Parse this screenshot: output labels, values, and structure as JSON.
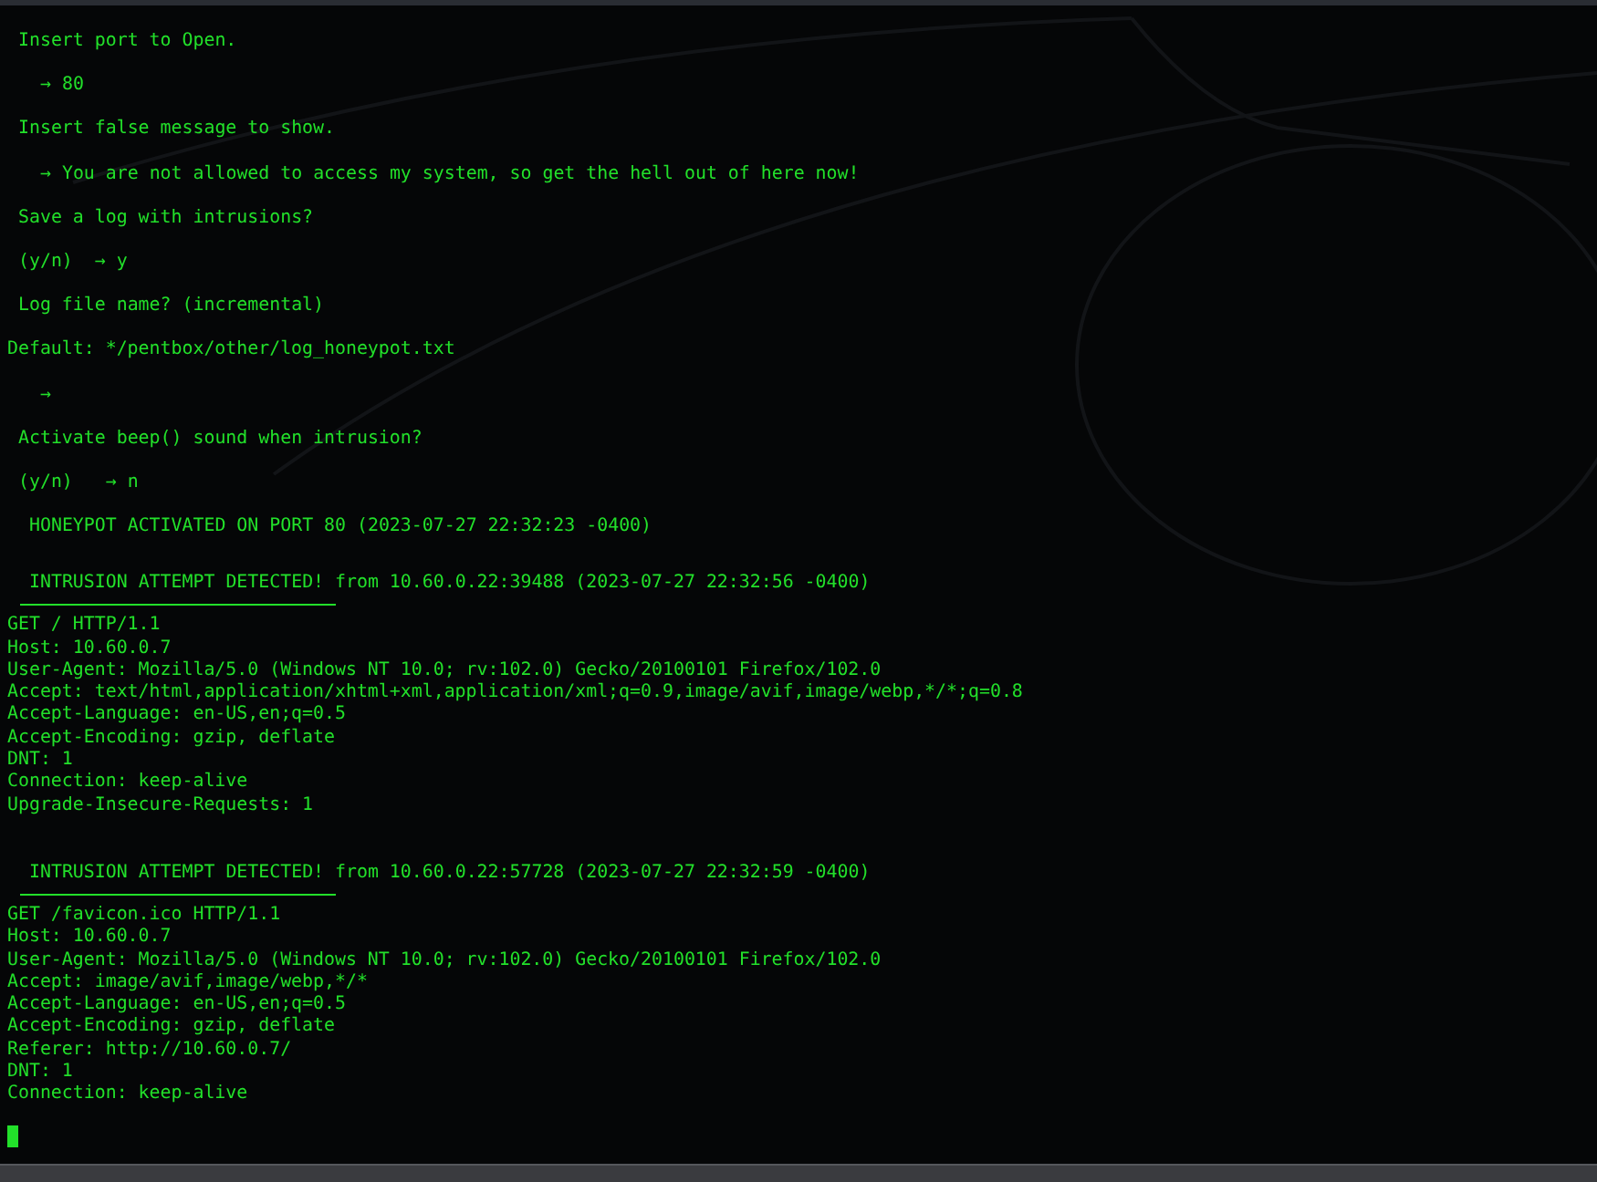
{
  "prompts": [
    {
      "kind": "question",
      "text": "Insert port to Open."
    },
    {
      "kind": "answer",
      "text": "→ 80"
    },
    {
      "kind": "question",
      "text": "Insert false message to show."
    },
    {
      "kind": "answer",
      "text": "→ You are not allowed to access my system, so get the hell out of here now!"
    },
    {
      "kind": "question",
      "text": "Save a log with intrusions?"
    },
    {
      "kind": "question",
      "text": "(y/n)  → y"
    },
    {
      "kind": "question",
      "text": "Log file name? (incremental)"
    },
    {
      "kind": "default",
      "text": "Default: */pentbox/other/log_honeypot.txt"
    },
    {
      "kind": "answer",
      "text": "→"
    },
    {
      "kind": "question",
      "text": "Activate beep() sound when intrusion?"
    },
    {
      "kind": "question",
      "text": "(y/n)   → n"
    },
    {
      "kind": "status",
      "text": "HONEYPOT ACTIVATED ON PORT 80 (2023-07-27 22:32:23 -0400)"
    }
  ],
  "intrusions": [
    {
      "title": "INTRUSION ATTEMPT DETECTED! from 10.60.0.22:39488 (2023-07-27 22:32:56 -0400)",
      "request": [
        "GET / HTTP/1.1",
        "Host: 10.60.0.7",
        "User-Agent: Mozilla/5.0 (Windows NT 10.0; rv:102.0) Gecko/20100101 Firefox/102.0",
        "Accept: text/html,application/xhtml+xml,application/xml;q=0.9,image/avif,image/webp,*/*;q=0.8",
        "Accept-Language: en-US,en;q=0.5",
        "Accept-Encoding: gzip, deflate",
        "DNT: 1",
        "Connection: keep-alive",
        "Upgrade-Insecure-Requests: 1"
      ]
    },
    {
      "title": "INTRUSION ATTEMPT DETECTED! from 10.60.0.22:57728 (2023-07-27 22:32:59 -0400)",
      "request": [
        "GET /favicon.ico HTTP/1.1",
        "Host: 10.60.0.7",
        "User-Agent: Mozilla/5.0 (Windows NT 10.0; rv:102.0) Gecko/20100101 Firefox/102.0",
        "Accept: image/avif,image/webp,*/*",
        "Accept-Language: en-US,en;q=0.5",
        "Accept-Encoding: gzip, deflate",
        "Referer: http://10.60.0.7/",
        "DNT: 1",
        "Connection: keep-alive"
      ]
    }
  ]
}
